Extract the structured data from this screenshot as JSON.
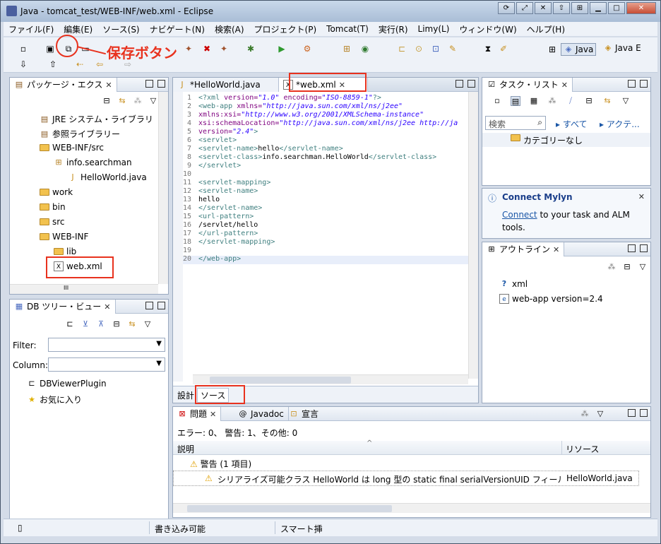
{
  "window": {
    "title": "Java - tomcat_test/WEB-INF/web.xml - Eclipse"
  },
  "menu": [
    "ファイル(F)",
    "編集(E)",
    "ソース(S)",
    "ナビゲート(N)",
    "検索(A)",
    "プロジェクト(P)",
    "Tomcat(T)",
    "実行(R)",
    "Limy(L)",
    "ウィンドウ(W)",
    "ヘルプ(H)"
  ],
  "annotation": {
    "save_button_label": "保存ボタン"
  },
  "perspectives": {
    "java": "Java",
    "java_ee": "Java E"
  },
  "package_explorer": {
    "title": "パッケージ・エクス",
    "items": [
      "JRE システム・ライブラリ",
      "参照ライブラリー",
      "WEB-INF/src",
      "info.searchman",
      "HelloWorld.java",
      "work",
      "bin",
      "src",
      "WEB-INF",
      "lib",
      "web.xml"
    ],
    "scroll_mark": "III"
  },
  "db_tree": {
    "title": "DB ツリー・ビュー",
    "filter_label": "Filter:",
    "column_label": "Column:",
    "items": [
      "DBViewerPlugin",
      "お気に入り"
    ]
  },
  "editor": {
    "tabs": [
      "*HelloWorld.java",
      "*web.xml"
    ],
    "bottom_tabs": [
      "設計",
      "ソース"
    ],
    "lines": [
      {
        "n": "1",
        "html": "<span class='tag'>&lt;?xml</span> <span class='att'>version=</span><span class='str'>\"1.0\"</span> <span class='att'>encoding=</span><span class='str'>\"ISO-8859-1\"</span><span class='tag'>?&gt;</span>"
      },
      {
        "n": "2",
        "html": "<span class='tag'>&lt;web-app</span> <span class='att'>xmlns=</span><span class='str'>\"http://java.sun.com/xml/ns/j2ee\"</span>"
      },
      {
        "n": "3",
        "html": "<span class='att'>xmlns:xsi=</span><span class='str'>\"http://www.w3.org/2001/XMLSchema-instance\"</span>"
      },
      {
        "n": "4",
        "html": "<span class='att'>xsi:schemaLocation=</span><span class='str'>\"http://java.sun.com/xml/ns/j2ee http://ja</span>"
      },
      {
        "n": "5",
        "html": "<span class='att'>version=</span><span class='str'>\"2.4\"</span><span class='tag'>&gt;</span>"
      },
      {
        "n": "6",
        "html": "<span class='tag'>&lt;servlet&gt;</span>"
      },
      {
        "n": "7",
        "html": "<span class='tag'>&lt;servlet-name&gt;</span>hello<span class='tag'>&lt;/servlet-name&gt;</span>"
      },
      {
        "n": "8",
        "html": "<span class='tag'>&lt;servlet-class&gt;</span>info.searchman.HelloWorld<span class='tag'>&lt;/servlet-class&gt;</span>"
      },
      {
        "n": "9",
        "html": "<span class='tag'>&lt;/servlet&gt;</span>"
      },
      {
        "n": "10",
        "html": ""
      },
      {
        "n": "11",
        "html": "<span class='tag'>&lt;servlet-mapping&gt;</span>"
      },
      {
        "n": "12",
        "html": "<span class='tag'>&lt;servlet-name&gt;</span>"
      },
      {
        "n": "13",
        "html": "hello"
      },
      {
        "n": "14",
        "html": "<span class='tag'>&lt;/servlet-name&gt;</span>"
      },
      {
        "n": "15",
        "html": "<span class='tag'>&lt;url-pattern&gt;</span>"
      },
      {
        "n": "16",
        "html": "/servlet/hello"
      },
      {
        "n": "17",
        "html": "<span class='tag'>&lt;/url-pattern&gt;</span>"
      },
      {
        "n": "18",
        "html": "<span class='tag'>&lt;/servlet-mapping&gt;</span>"
      },
      {
        "n": "19",
        "html": ""
      },
      {
        "n": "20",
        "html": "<span class='tag'>&lt;/web-app&gt;</span>"
      }
    ]
  },
  "task_list": {
    "title": "タスク・リスト",
    "search_placeholder": "検索",
    "all_label": "すべて",
    "activate_label": "アクテ...",
    "category": "カテゴリーなし"
  },
  "mylyn": {
    "title": "Connect Mylyn",
    "link": "Connect",
    "text": " to your task and ALM tools."
  },
  "outline": {
    "title": "アウトライン",
    "items": [
      "xml",
      "web-app version=2.4"
    ]
  },
  "problems": {
    "tabs": [
      "問題",
      "Javadoc",
      "宣言"
    ],
    "summary": "エラー: 0、 警告: 1、その他: 0",
    "columns": [
      "説明",
      "リソース"
    ],
    "group": "警告 (1 項目)",
    "row_desc": "シリアライズ可能クラス HelloWorld は long 型の static final serialVersionUID フィール",
    "row_res": "HelloWorld.java"
  },
  "status": {
    "writable": "書き込み可能",
    "insert": "スマート挿"
  },
  "colors": {
    "annotation": "#e8321e"
  }
}
